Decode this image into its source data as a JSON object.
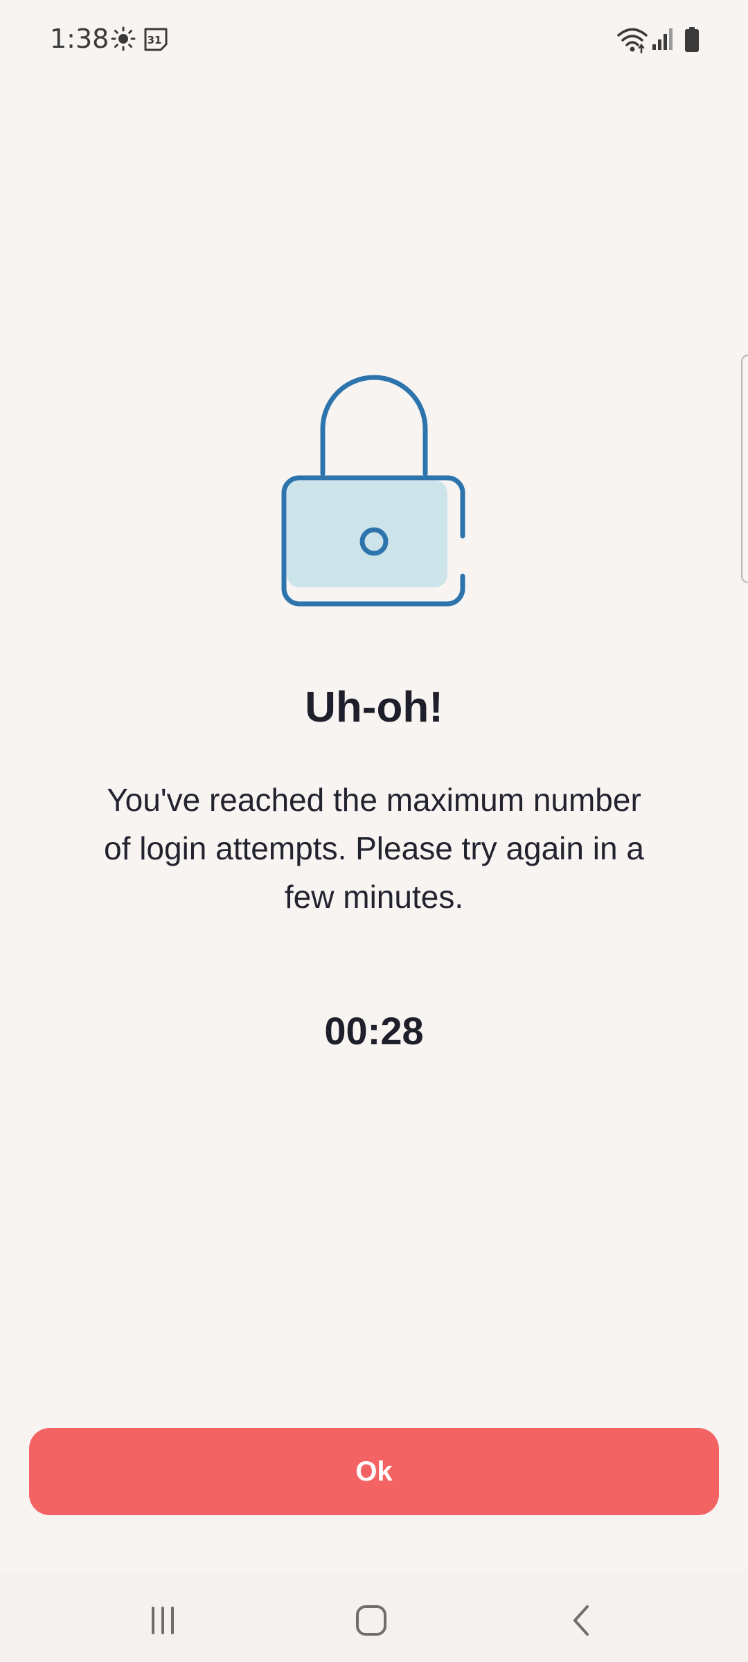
{
  "status_bar": {
    "time": "1:38",
    "icons": [
      "sun-icon",
      "calendar-icon",
      "wifi-icon",
      "signal-icon",
      "battery-icon"
    ],
    "calendar_day": "31"
  },
  "lockout": {
    "illustration": "lock-icon",
    "title": "Uh-oh!",
    "message": "You've reached the maximum number of login attempts. Please try again in a few minutes.",
    "countdown": "00:28"
  },
  "actions": {
    "ok_label": "Ok"
  },
  "nav_bar": {
    "icons": [
      "recent-apps-icon",
      "home-icon",
      "back-icon"
    ]
  },
  "colors": {
    "background": "#f7f4f2",
    "accent_button": "#f46363",
    "lock_stroke": "#2e74ac",
    "lock_fill": "#cce3ea",
    "text_primary": "#1f1f2b"
  }
}
